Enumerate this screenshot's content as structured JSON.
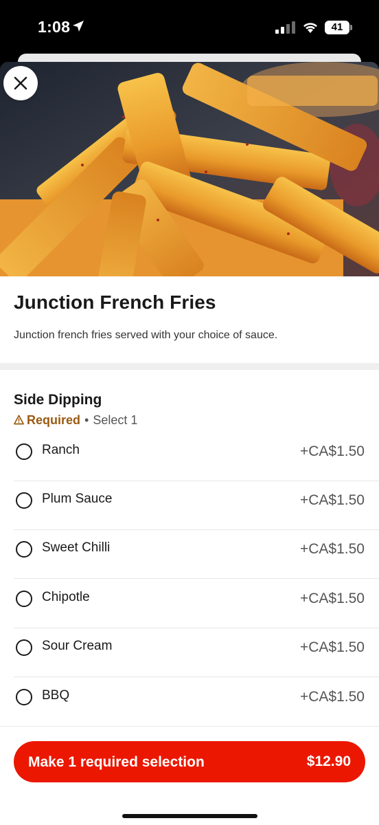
{
  "status_bar": {
    "time": "1:08",
    "battery": "41"
  },
  "item": {
    "title": "Junction French Fries",
    "description": "Junction french fries served with your choice of sauce."
  },
  "group": {
    "title": "Side Dipping",
    "required_label": "Required",
    "separator": "•",
    "select_hint": "Select 1",
    "options": [
      {
        "label": "Ranch",
        "price": "+CA$1.50"
      },
      {
        "label": "Plum Sauce",
        "price": "+CA$1.50"
      },
      {
        "label": "Sweet Chilli",
        "price": "+CA$1.50"
      },
      {
        "label": "Chipotle",
        "price": "+CA$1.50"
      },
      {
        "label": "Sour Cream",
        "price": "+CA$1.50"
      },
      {
        "label": "BBQ",
        "price": "+CA$1.50"
      }
    ]
  },
  "cta": {
    "label": "Make 1 required selection",
    "price": "$12.90"
  },
  "colors": {
    "brand_red": "#eb1700",
    "required_brown": "#9a5a12"
  }
}
